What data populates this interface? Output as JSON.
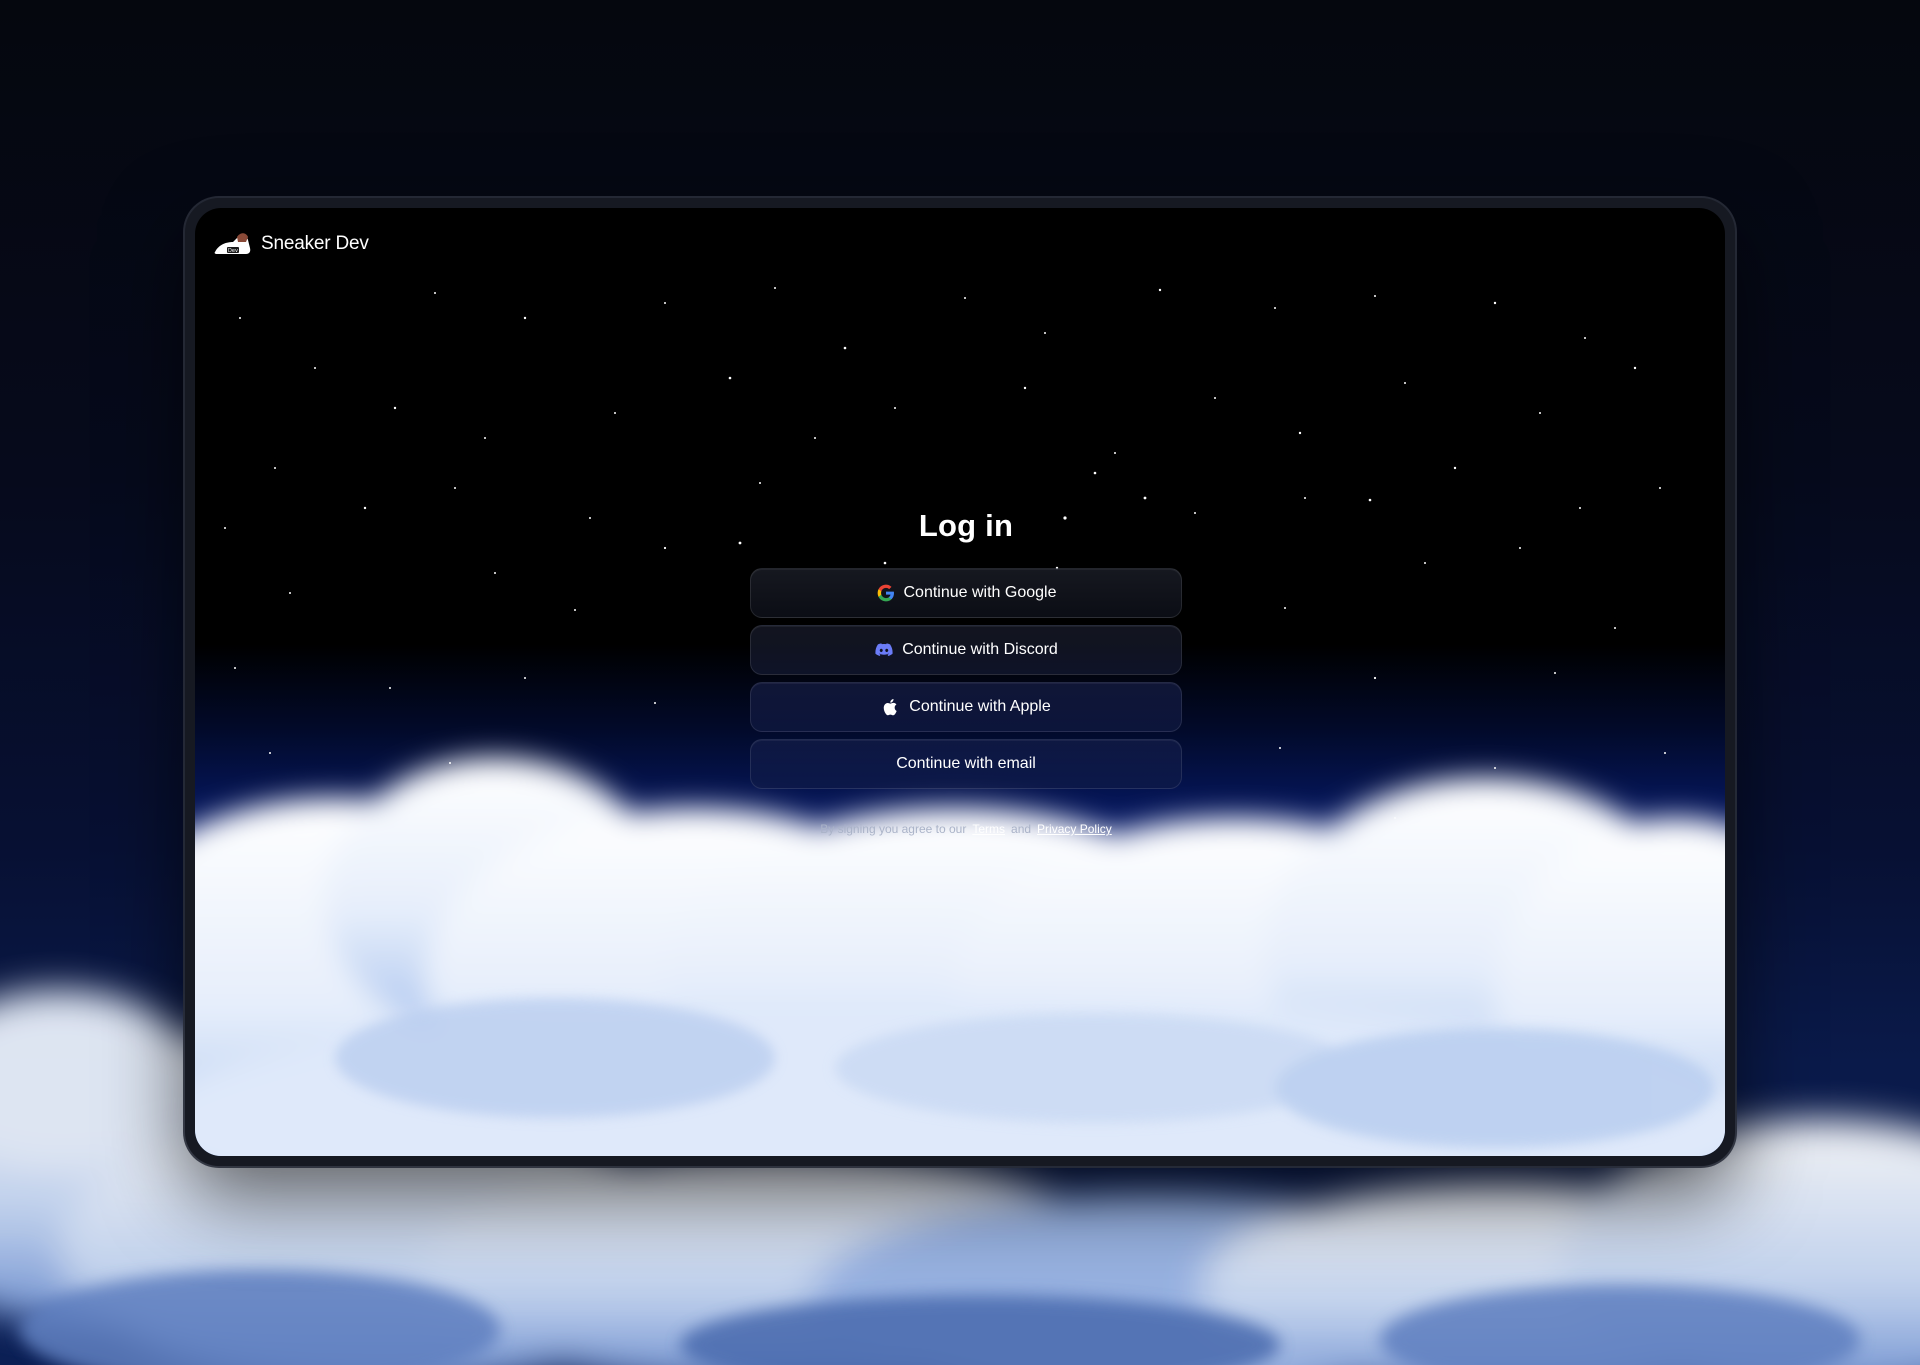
{
  "brand": {
    "name": "Sneaker Dev",
    "logo_icon": "sneaker-logo-icon",
    "logo_badge": "Dev"
  },
  "login": {
    "title": "Log in",
    "buttons": [
      {
        "label": "Continue with Google",
        "icon": "google-icon"
      },
      {
        "label": "Continue with Discord",
        "icon": "discord-icon"
      },
      {
        "label": "Continue with Apple",
        "icon": "apple-icon"
      },
      {
        "label": "Continue with email",
        "icon": ""
      }
    ],
    "legal": {
      "prefix": "By signing you agree to our",
      "terms": "Terms",
      "and": "and",
      "privacy": "Privacy Policy"
    }
  },
  "colors": {
    "sky_top": "#000000",
    "sky_blue": "#0a2a96",
    "cloud": "#ffffff",
    "accent_google_red": "#ea4335",
    "accent_discord": "#5865f2"
  }
}
